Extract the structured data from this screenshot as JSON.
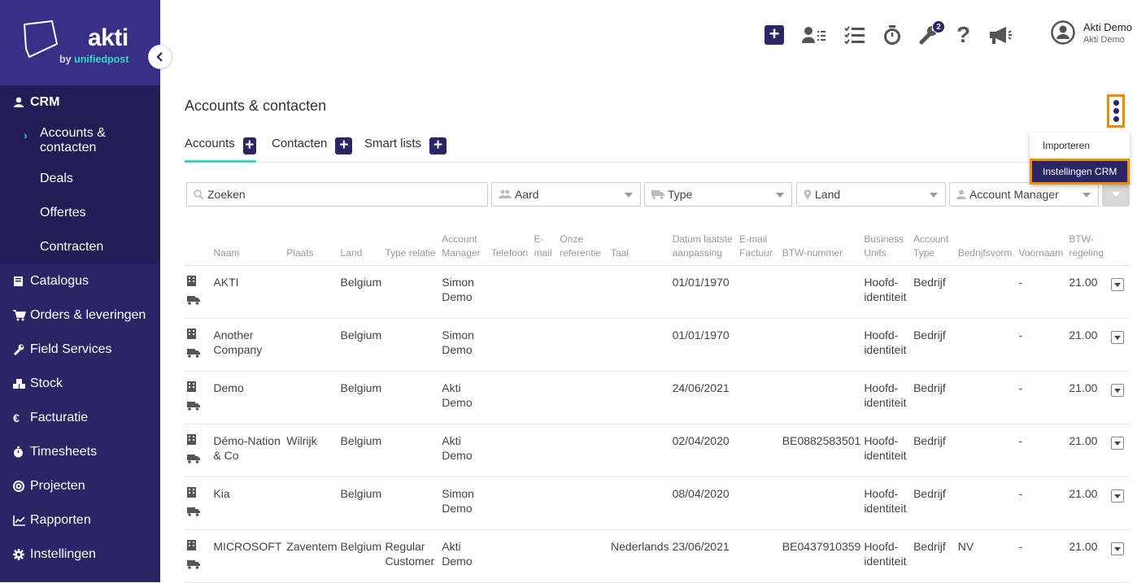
{
  "brand": {
    "name": "akti",
    "by_prefix": "by ",
    "by_name": "unifiedpost"
  },
  "sidebar": {
    "section": "CRM",
    "sub_items": [
      {
        "label": "Accounts & contacten",
        "active": true
      },
      {
        "label": "Deals"
      },
      {
        "label": "Offertes"
      },
      {
        "label": "Contracten"
      }
    ],
    "items": [
      {
        "label": "Catalogus",
        "icon": "book-icon"
      },
      {
        "label": "Orders & leveringen",
        "icon": "cart-icon"
      },
      {
        "label": "Field Services",
        "icon": "wrench-icon"
      },
      {
        "label": "Stock",
        "icon": "boxes-icon"
      },
      {
        "label": "Facturatie",
        "icon": "euro-icon"
      },
      {
        "label": "Timesheets",
        "icon": "stopwatch-icon"
      },
      {
        "label": "Projecten",
        "icon": "target-icon"
      },
      {
        "label": "Rapporten",
        "icon": "chart-icon"
      },
      {
        "label": "Instellingen",
        "icon": "gear-icon"
      }
    ]
  },
  "topbar": {
    "badge_count": "2",
    "user": {
      "name": "Akti Demo",
      "company": "Akti Demo"
    }
  },
  "page": {
    "title": "Accounts & contacten"
  },
  "menu": {
    "items": [
      "Importeren",
      "Instellingen CRM"
    ]
  },
  "tabs": [
    "Accounts",
    "Contacten",
    "Smart lists"
  ],
  "filters": {
    "search_placeholder": "Zoeken",
    "aard": "Aard",
    "type": "Type",
    "land": "Land",
    "account_manager": "Account Manager"
  },
  "table": {
    "headers": [
      "",
      "Naam",
      "Plaats",
      "Land",
      "Type relatie",
      "Account Manager",
      "Telefoon",
      "E-mail",
      "Onze referentie",
      "Taal",
      "Datum laatste aanpassing",
      "E-mail Factuur",
      "BTW-nummer",
      "Business Units",
      "Account Type",
      "Bedrijfsvorm",
      "Voornaam",
      "BTW-regeling",
      ""
    ],
    "rows": [
      {
        "naam": "AKTI",
        "plaats": "",
        "land": "Belgium",
        "type_relatie": "",
        "manager": "Simon Demo",
        "telefoon": "",
        "email": "",
        "ref": "",
        "taal": "",
        "datum": "01/01/1970",
        "email_factuur": "",
        "btw": "",
        "bu": "Hoofd-identiteit",
        "acc_type": "Bedrijf",
        "bedrijfsvorm": "",
        "voornaam": "-",
        "btw_regeling": "21.00"
      },
      {
        "naam": "Another Company",
        "plaats": "",
        "land": "Belgium",
        "type_relatie": "",
        "manager": "Simon Demo",
        "telefoon": "",
        "email": "",
        "ref": "",
        "taal": "",
        "datum": "01/01/1970",
        "email_factuur": "",
        "btw": "",
        "bu": "Hoofd-identiteit",
        "acc_type": "Bedrijf",
        "bedrijfsvorm": "",
        "voornaam": "-",
        "btw_regeling": "21.00"
      },
      {
        "naam": "Demo",
        "plaats": "",
        "land": "Belgium",
        "type_relatie": "",
        "manager": "Akti Demo",
        "telefoon": "",
        "email": "",
        "ref": "",
        "taal": "",
        "datum": "24/06/2021",
        "email_factuur": "",
        "btw": "",
        "bu": "Hoofd-identiteit",
        "acc_type": "Bedrijf",
        "bedrijfsvorm": "",
        "voornaam": "-",
        "btw_regeling": "21.00"
      },
      {
        "naam": "Démo-Nation & Co",
        "plaats": "Wilrijk",
        "land": "Belgium",
        "type_relatie": "",
        "manager": "Akti Demo",
        "telefoon": "",
        "email": "",
        "ref": "",
        "taal": "",
        "datum": "02/04/2020",
        "email_factuur": "",
        "btw": "BE0882583501",
        "bu": "Hoofd-identiteit",
        "acc_type": "Bedrijf",
        "bedrijfsvorm": "",
        "voornaam": "-",
        "btw_regeling": "21.00"
      },
      {
        "naam": "Kia",
        "plaats": "",
        "land": "Belgium",
        "type_relatie": "",
        "manager": "Simon Demo",
        "telefoon": "",
        "email": "",
        "ref": "",
        "taal": "",
        "datum": "08/04/2020",
        "email_factuur": "",
        "btw": "",
        "bu": "Hoofd-identiteit",
        "acc_type": "Bedrijf",
        "bedrijfsvorm": "",
        "voornaam": "-",
        "btw_regeling": "21.00"
      },
      {
        "naam": "MICROSOFT",
        "plaats": "Zaventem",
        "land": "Belgium",
        "type_relatie": "Regular Customer",
        "manager": "Akti Demo",
        "telefoon": "",
        "email": "",
        "ref": "",
        "taal": "Nederlands",
        "datum": "23/06/2021",
        "email_factuur": "",
        "btw": "BE0437910359",
        "bu": "Hoofd-identiteit",
        "acc_type": "Bedrijf",
        "bedrijfsvorm": "NV",
        "voornaam": "-",
        "btw_regeling": "21.00"
      }
    ]
  },
  "colors": {
    "sidebar": "#2b2566",
    "accent": "#30d6cf",
    "highlight": "#f08c00"
  }
}
